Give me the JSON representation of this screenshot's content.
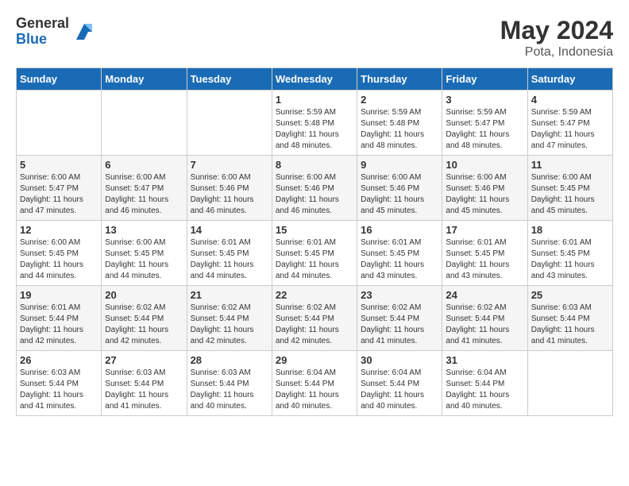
{
  "header": {
    "logo_general": "General",
    "logo_blue": "Blue",
    "month_title": "May 2024",
    "location": "Pota, Indonesia"
  },
  "days_of_week": [
    "Sunday",
    "Monday",
    "Tuesday",
    "Wednesday",
    "Thursday",
    "Friday",
    "Saturday"
  ],
  "weeks": [
    [
      {
        "day": "",
        "sunrise": "",
        "sunset": "",
        "daylight": ""
      },
      {
        "day": "",
        "sunrise": "",
        "sunset": "",
        "daylight": ""
      },
      {
        "day": "",
        "sunrise": "",
        "sunset": "",
        "daylight": ""
      },
      {
        "day": "1",
        "sunrise": "Sunrise: 5:59 AM",
        "sunset": "Sunset: 5:48 PM",
        "daylight": "Daylight: 11 hours and 48 minutes."
      },
      {
        "day": "2",
        "sunrise": "Sunrise: 5:59 AM",
        "sunset": "Sunset: 5:48 PM",
        "daylight": "Daylight: 11 hours and 48 minutes."
      },
      {
        "day": "3",
        "sunrise": "Sunrise: 5:59 AM",
        "sunset": "Sunset: 5:47 PM",
        "daylight": "Daylight: 11 hours and 48 minutes."
      },
      {
        "day": "4",
        "sunrise": "Sunrise: 5:59 AM",
        "sunset": "Sunset: 5:47 PM",
        "daylight": "Daylight: 11 hours and 47 minutes."
      }
    ],
    [
      {
        "day": "5",
        "sunrise": "Sunrise: 6:00 AM",
        "sunset": "Sunset: 5:47 PM",
        "daylight": "Daylight: 11 hours and 47 minutes."
      },
      {
        "day": "6",
        "sunrise": "Sunrise: 6:00 AM",
        "sunset": "Sunset: 5:47 PM",
        "daylight": "Daylight: 11 hours and 46 minutes."
      },
      {
        "day": "7",
        "sunrise": "Sunrise: 6:00 AM",
        "sunset": "Sunset: 5:46 PM",
        "daylight": "Daylight: 11 hours and 46 minutes."
      },
      {
        "day": "8",
        "sunrise": "Sunrise: 6:00 AM",
        "sunset": "Sunset: 5:46 PM",
        "daylight": "Daylight: 11 hours and 46 minutes."
      },
      {
        "day": "9",
        "sunrise": "Sunrise: 6:00 AM",
        "sunset": "Sunset: 5:46 PM",
        "daylight": "Daylight: 11 hours and 45 minutes."
      },
      {
        "day": "10",
        "sunrise": "Sunrise: 6:00 AM",
        "sunset": "Sunset: 5:46 PM",
        "daylight": "Daylight: 11 hours and 45 minutes."
      },
      {
        "day": "11",
        "sunrise": "Sunrise: 6:00 AM",
        "sunset": "Sunset: 5:45 PM",
        "daylight": "Daylight: 11 hours and 45 minutes."
      }
    ],
    [
      {
        "day": "12",
        "sunrise": "Sunrise: 6:00 AM",
        "sunset": "Sunset: 5:45 PM",
        "daylight": "Daylight: 11 hours and 44 minutes."
      },
      {
        "day": "13",
        "sunrise": "Sunrise: 6:00 AM",
        "sunset": "Sunset: 5:45 PM",
        "daylight": "Daylight: 11 hours and 44 minutes."
      },
      {
        "day": "14",
        "sunrise": "Sunrise: 6:01 AM",
        "sunset": "Sunset: 5:45 PM",
        "daylight": "Daylight: 11 hours and 44 minutes."
      },
      {
        "day": "15",
        "sunrise": "Sunrise: 6:01 AM",
        "sunset": "Sunset: 5:45 PM",
        "daylight": "Daylight: 11 hours and 44 minutes."
      },
      {
        "day": "16",
        "sunrise": "Sunrise: 6:01 AM",
        "sunset": "Sunset: 5:45 PM",
        "daylight": "Daylight: 11 hours and 43 minutes."
      },
      {
        "day": "17",
        "sunrise": "Sunrise: 6:01 AM",
        "sunset": "Sunset: 5:45 PM",
        "daylight": "Daylight: 11 hours and 43 minutes."
      },
      {
        "day": "18",
        "sunrise": "Sunrise: 6:01 AM",
        "sunset": "Sunset: 5:45 PM",
        "daylight": "Daylight: 11 hours and 43 minutes."
      }
    ],
    [
      {
        "day": "19",
        "sunrise": "Sunrise: 6:01 AM",
        "sunset": "Sunset: 5:44 PM",
        "daylight": "Daylight: 11 hours and 42 minutes."
      },
      {
        "day": "20",
        "sunrise": "Sunrise: 6:02 AM",
        "sunset": "Sunset: 5:44 PM",
        "daylight": "Daylight: 11 hours and 42 minutes."
      },
      {
        "day": "21",
        "sunrise": "Sunrise: 6:02 AM",
        "sunset": "Sunset: 5:44 PM",
        "daylight": "Daylight: 11 hours and 42 minutes."
      },
      {
        "day": "22",
        "sunrise": "Sunrise: 6:02 AM",
        "sunset": "Sunset: 5:44 PM",
        "daylight": "Daylight: 11 hours and 42 minutes."
      },
      {
        "day": "23",
        "sunrise": "Sunrise: 6:02 AM",
        "sunset": "Sunset: 5:44 PM",
        "daylight": "Daylight: 11 hours and 41 minutes."
      },
      {
        "day": "24",
        "sunrise": "Sunrise: 6:02 AM",
        "sunset": "Sunset: 5:44 PM",
        "daylight": "Daylight: 11 hours and 41 minutes."
      },
      {
        "day": "25",
        "sunrise": "Sunrise: 6:03 AM",
        "sunset": "Sunset: 5:44 PM",
        "daylight": "Daylight: 11 hours and 41 minutes."
      }
    ],
    [
      {
        "day": "26",
        "sunrise": "Sunrise: 6:03 AM",
        "sunset": "Sunset: 5:44 PM",
        "daylight": "Daylight: 11 hours and 41 minutes."
      },
      {
        "day": "27",
        "sunrise": "Sunrise: 6:03 AM",
        "sunset": "Sunset: 5:44 PM",
        "daylight": "Daylight: 11 hours and 41 minutes."
      },
      {
        "day": "28",
        "sunrise": "Sunrise: 6:03 AM",
        "sunset": "Sunset: 5:44 PM",
        "daylight": "Daylight: 11 hours and 40 minutes."
      },
      {
        "day": "29",
        "sunrise": "Sunrise: 6:04 AM",
        "sunset": "Sunset: 5:44 PM",
        "daylight": "Daylight: 11 hours and 40 minutes."
      },
      {
        "day": "30",
        "sunrise": "Sunrise: 6:04 AM",
        "sunset": "Sunset: 5:44 PM",
        "daylight": "Daylight: 11 hours and 40 minutes."
      },
      {
        "day": "31",
        "sunrise": "Sunrise: 6:04 AM",
        "sunset": "Sunset: 5:44 PM",
        "daylight": "Daylight: 11 hours and 40 minutes."
      },
      {
        "day": "",
        "sunrise": "",
        "sunset": "",
        "daylight": ""
      }
    ]
  ]
}
